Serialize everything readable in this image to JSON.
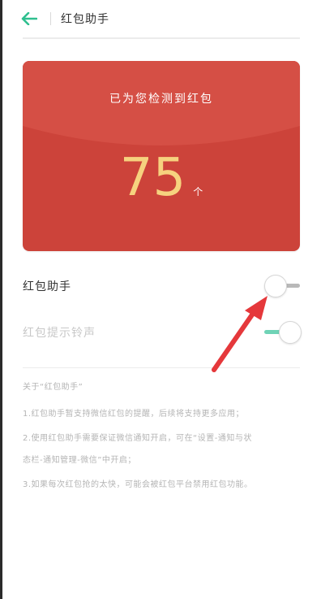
{
  "header": {
    "title": "红包助手",
    "back_icon": "arrow-left-icon",
    "accent_color": "#2fbf8f"
  },
  "card": {
    "caption": "已为您检测到红包",
    "count": "75",
    "unit": "个",
    "background_color": "#cc433a",
    "flap_color": "#d54f45",
    "count_color": "#f6d27f"
  },
  "settings": [
    {
      "label": "红包助手",
      "state": "off"
    },
    {
      "label": "红包提示铃声",
      "state": "on"
    }
  ],
  "about": {
    "title": "关于“红包助手”",
    "lines": [
      "1.红包助手暂支持微信红包的提醒，后续将支持更多应用；",
      "2.使用红包助手需要保证微信通知开启，可在“设置-通知与状",
      "态栏-通知管理-微信”中开启；",
      "3.如果每次红包抢的太快，可能会被红包平台禁用红包功能。"
    ]
  },
  "annotation": {
    "arrow_icon": "red-arrow-icon",
    "color": "#e5383b"
  }
}
